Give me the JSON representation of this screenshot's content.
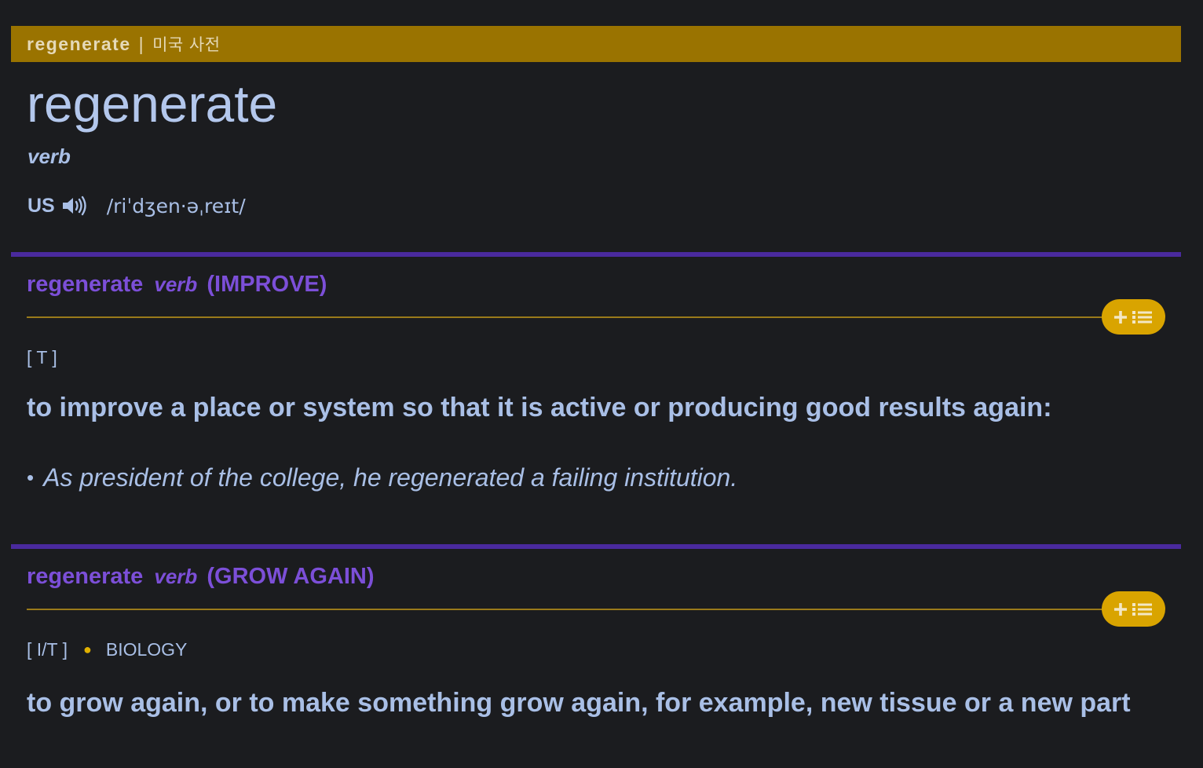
{
  "header": {
    "word": "regenerate",
    "separator": "|",
    "dictionary": "미국 사전"
  },
  "entry": {
    "headword": "regenerate",
    "part_of_speech": "verb",
    "pronunciation": {
      "region": "US",
      "ipa": "/riˈdʒen·əˌreɪt/",
      "icon": "speaker-icon"
    }
  },
  "senses": [
    {
      "word": "regenerate",
      "pos": "verb",
      "guideword": "(IMPROVE)",
      "grammar": "[ T ]",
      "domain": "",
      "definition": "to improve a place or system so that it is active or producing good results again:",
      "examples": [
        "As president of the college, he regenerated a failing institution."
      ],
      "add_button_icon": "plus-list-icon"
    },
    {
      "word": "regenerate",
      "pos": "verb",
      "guideword": "(GROW AGAIN)",
      "grammar": "[ I/T ]",
      "domain": "BIOLOGY",
      "definition": "to grow again, or to make something grow again, for example, new tissue or a new part",
      "examples": [],
      "add_button_icon": "plus-list-icon"
    }
  ],
  "colors": {
    "background": "#1b1c1f",
    "header_bar": "#9a7300",
    "divider": "#4a2a9e",
    "sense_heading": "#7c4fd8",
    "text": "#a9bfe6",
    "button": "#d9a400"
  }
}
